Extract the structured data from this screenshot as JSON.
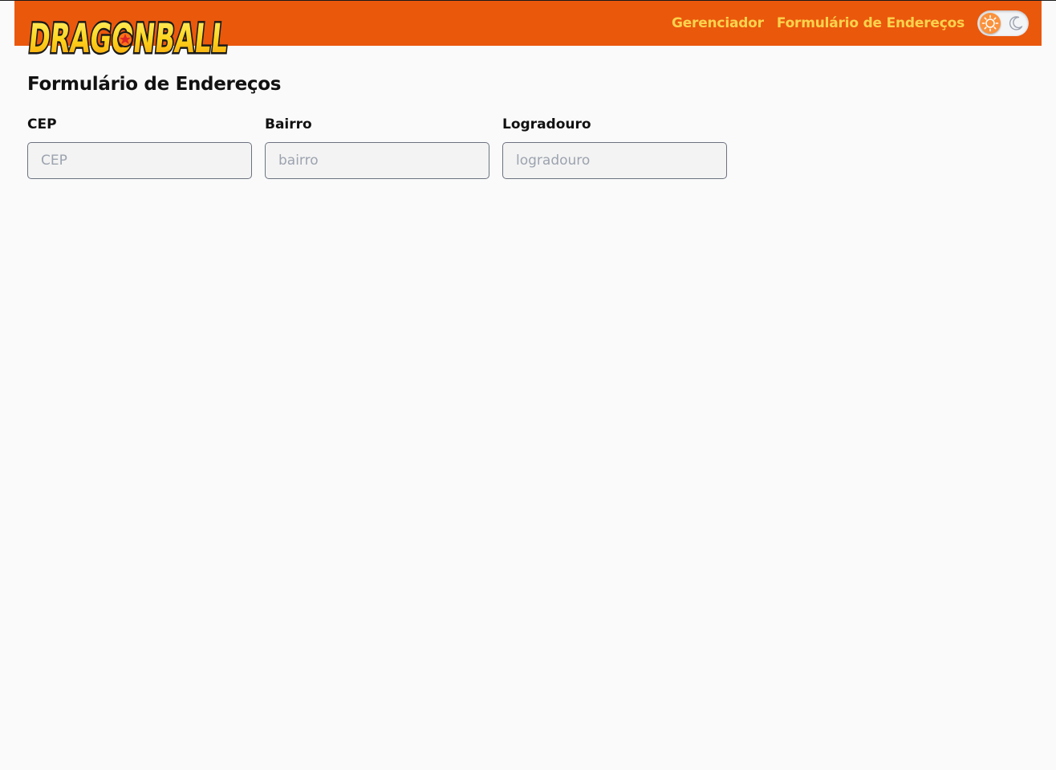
{
  "header": {
    "logo_text": "DRAGONBALL",
    "nav": [
      {
        "label": "Gerenciador"
      },
      {
        "label": "Formulário de Endereços"
      }
    ],
    "theme_toggle": {
      "state": "light",
      "knob_icon": "sun-icon",
      "other_icon": "moon-icon"
    }
  },
  "page": {
    "title": "Formulário de Endereços"
  },
  "form": {
    "fields": [
      {
        "label": "CEP",
        "placeholder": "CEP",
        "value": ""
      },
      {
        "label": "Bairro",
        "placeholder": "bairro",
        "value": ""
      },
      {
        "label": "Logradouro",
        "placeholder": "logradouro",
        "value": ""
      }
    ]
  },
  "colors": {
    "navbar": "#ea580c",
    "nav_link": "#fcd34d",
    "background": "#fafafa",
    "input_border": "#6b7280"
  }
}
